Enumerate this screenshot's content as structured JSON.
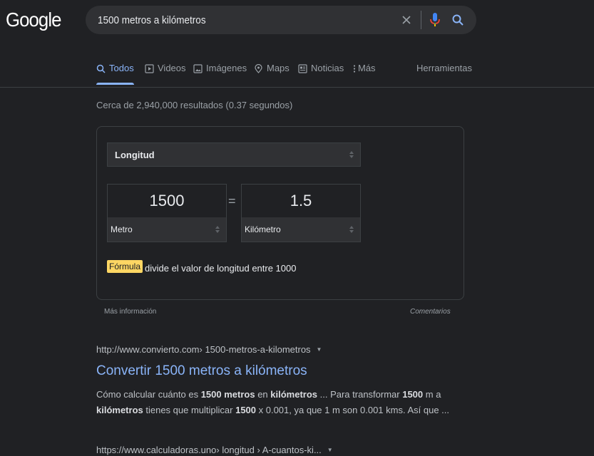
{
  "logo": "Google",
  "search": {
    "query": "1500 metros a kilómetros"
  },
  "tabs": [
    {
      "label": "Todos",
      "icon": "search-icon"
    },
    {
      "label": "Videos",
      "icon": "play-icon"
    },
    {
      "label": "Imágenes",
      "icon": "image-icon"
    },
    {
      "label": "Maps",
      "icon": "map-pin-icon"
    },
    {
      "label": "Noticias",
      "icon": "news-icon"
    },
    {
      "label": "Más",
      "icon": "more-vert-icon"
    }
  ],
  "tools_label": "Herramientas",
  "result_stats": "Cerca de 2,940,000 resultados (0.37 segundos)",
  "converter": {
    "category": "Longitud",
    "from_value": "1500",
    "from_unit": "Metro",
    "equals": "=",
    "to_value": "1.5",
    "to_unit": "Kilómetro",
    "formula_label": "Fórmula",
    "formula_text": "divide el valor de longitud entre 1000",
    "more_info": "Más información",
    "comments": "Comentarios"
  },
  "results": [
    {
      "cite_domain": "http://www.convierto.com",
      "cite_path": " › 1500-metros-a-kilometros",
      "title": "Convertir 1500 metros a kilómetros",
      "snippet_parts": [
        {
          "t": "Cómo calcular cuánto es ",
          "b": false
        },
        {
          "t": "1500 metros",
          "b": true
        },
        {
          "t": " en ",
          "b": false
        },
        {
          "t": "kilómetros",
          "b": true
        },
        {
          "t": " ... Para transformar ",
          "b": false
        },
        {
          "t": "1500",
          "b": true
        },
        {
          "t": " m a ",
          "b": false
        },
        {
          "t": "kilómetros",
          "b": true
        },
        {
          "t": " tienes que multiplicar ",
          "b": false
        },
        {
          "t": "1500",
          "b": true
        },
        {
          "t": " x 0.001, ya que 1 m son 0.001 kms. Así que ...",
          "b": false
        }
      ]
    },
    {
      "cite_domain": "https://www.calculadoras.uno",
      "cite_path": " › longitud › A-cuantos-ki..."
    }
  ],
  "colors": {
    "background": "#202124",
    "link": "#8ab4f8",
    "badge": "#fdd663",
    "mic": "#8ab4f8"
  }
}
